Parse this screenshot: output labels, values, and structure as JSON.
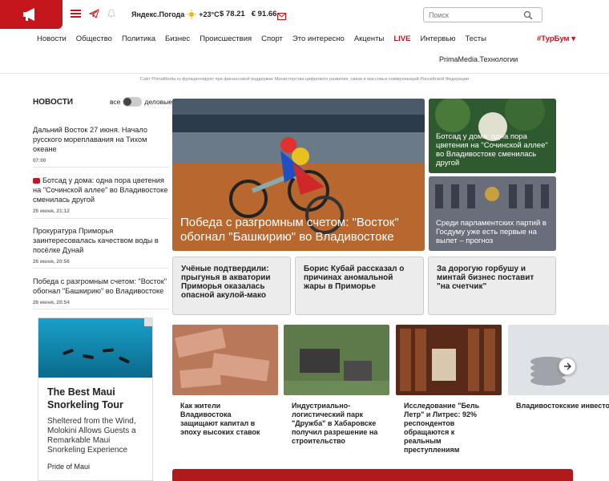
{
  "colors": {
    "brand": "#c4161c",
    "text": "#222222"
  },
  "header": {
    "logo_icon": "megaphone-icon",
    "weather_label": "Яндекс.Погода",
    "weather_value": "+23°C",
    "usd": "$ 78.21",
    "eur": "€ 91.66",
    "search_placeholder": "Поиск"
  },
  "nav": {
    "items": [
      "Новости",
      "Общество",
      "Политика",
      "Бизнес",
      "Происшествия",
      "Спорт",
      "Это интересно",
      "Акценты",
      "LIVE",
      "Интервью",
      "Тесты"
    ],
    "turbum": "#ТурБум",
    "sub": "PrimaMedia.Технологии"
  },
  "notice": "Сайт PrimaMedia.ru функционирует при финансовой поддержке Министерства цифрового развития, связи и массовых коммуникаций Российской Федерации",
  "news": {
    "heading": "НОВОСТИ",
    "toggle_all": "все",
    "toggle_biz": "деловые",
    "items": [
      {
        "title": "Дальний Восток 27 июня. Начало русского мореплавания на Тихом океане",
        "time": "07:00"
      },
      {
        "title": "Ботсад у дома: одна пора цветения на \"Сочинской аллее\" во Владивостоке сменилась другой",
        "time": "26 июня, 21:12"
      },
      {
        "title": "Прокуратура Приморья заинтересовалась качеством воды в посёлке Дунай",
        "time": "26 июня, 20:56"
      },
      {
        "title": "Победа с разгромным счетом: \"Восток\" обогнал \"Башкирию\" во Владивостоке",
        "time": "26 июня, 20:54"
      }
    ]
  },
  "ad": {
    "title": "The Best Maui Snorkeling Tour",
    "desc": "Sheltered from the Wind, Molokini Allows Guests a Remarkable Maui Snorkeling Experience",
    "brand": "Pride of Maui"
  },
  "hero": {
    "caption": "Победа с разгромным счетом: \"Восток\" обогнал \"Башкирию\" во Владивостоке"
  },
  "side": [
    {
      "caption": "Ботсад у дома: одна пора цветения на \"Сочинской аллее\" во Владивостоке сменилась другой"
    },
    {
      "caption": "Среди парламентских партий в Госдуму уже есть первые на вылет – прогноз"
    }
  ],
  "grey_cards": [
    "Учёные подтвердили: прыгунья в акватории Приморья оказалась опасной акулой-мако",
    "Борис Кубай рассказал о причинах аномальной жары в Приморье",
    "За дорогую горбушу и минтай бизнес поставит \"на счетчик\""
  ],
  "tiles": [
    "Как жители Владивостока защищают капитал в эпоху высоких ставок",
    "Индустриально-логистический парк \"Дружба\" в Хабаровске получил разрешение на строительство",
    "Исследование \"Бель Летр\" и Литрес: 92% респондентов обращаются к реальным преступлениям",
    "Владивостокские инвесторы ищут возможности на стагнации мест"
  ]
}
